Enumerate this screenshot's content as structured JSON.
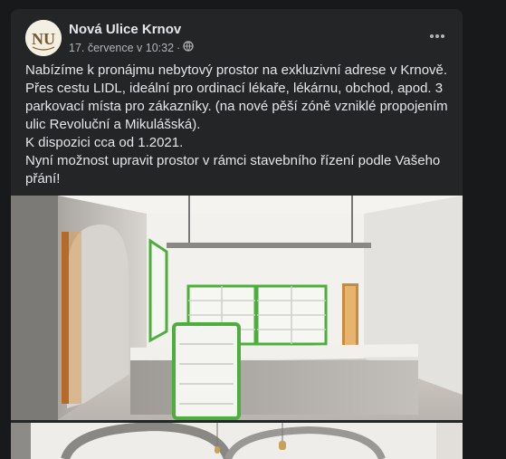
{
  "post": {
    "page_name": "Nová Ulice Krnov",
    "timestamp": "17. července v 10:32",
    "separator": "·",
    "audience_icon": "globe-icon",
    "more_icon": "more-dots-icon",
    "avatar_monogram": "NU",
    "text_lines": [
      "Nabízíme k pronájmu nebytový prostor na exkluzivní adrese v Krnově.",
      "Přes cestu LIDL, ideální pro ordinací lékaře, lékárnu, obchod, apod. 3",
      "parkovací místa pro zákazníky. (na nové pěší zóně vzniklé propojením",
      "ulic Revoluční a Mikulášská).",
      "K dispozici cca od 1.2021.",
      "Nyní možnost upravit prostor v rámci stavebního řízení podle Vašeho",
      "přání!"
    ]
  },
  "colors": {
    "page_bg": "#18191a",
    "card_bg": "#242526",
    "primary_text": "#e4e6eb",
    "secondary_text": "#b0b3b8",
    "shelf_accent": "#4caf3c"
  }
}
